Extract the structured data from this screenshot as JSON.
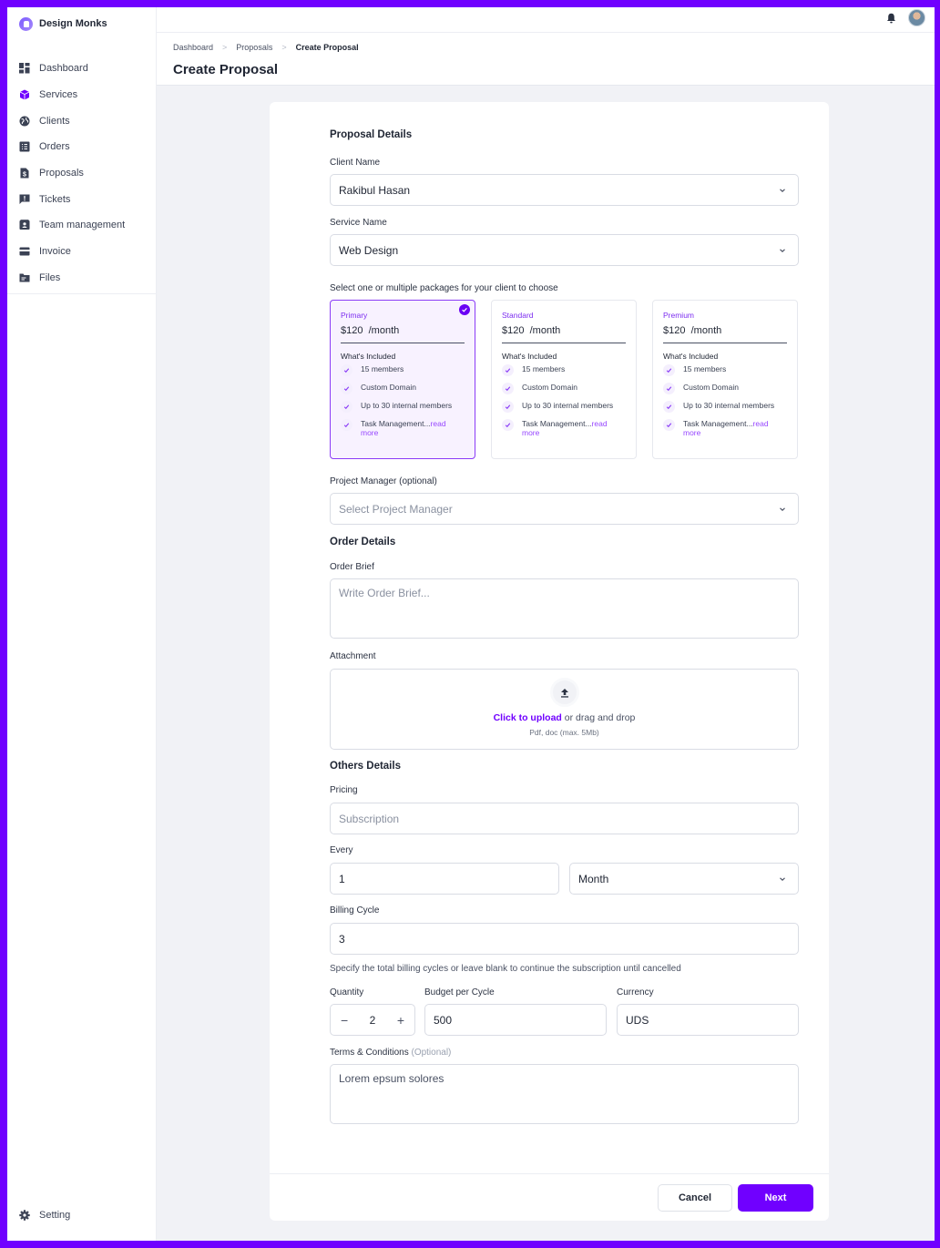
{
  "app": {
    "brand": "Design Monks",
    "colors": {
      "accent": "#7000ff",
      "frame": "#7000ff",
      "package_label": "#7c2df0"
    }
  },
  "sidebar": {
    "items": [
      {
        "label": "Dashboard",
        "icon": "dashboard-icon"
      },
      {
        "label": "Services",
        "icon": "box-icon"
      },
      {
        "label": "Clients",
        "icon": "globe-icon"
      },
      {
        "label": "Orders",
        "icon": "list-icon"
      },
      {
        "label": "Proposals",
        "icon": "document-dollar-icon"
      },
      {
        "label": "Tickets",
        "icon": "message-alert-icon"
      },
      {
        "label": "Team management",
        "icon": "contact-card-icon"
      },
      {
        "label": "Invoice",
        "icon": "credit-card-icon"
      },
      {
        "label": "Files",
        "icon": "folder-icon"
      }
    ],
    "setting": "Setting"
  },
  "breadcrumb": [
    "Dashboard",
    "Proposals",
    "Create Proposal"
  ],
  "page_title": "Create Proposal",
  "form": {
    "proposal_details_heading": "Proposal Details",
    "client_name": {
      "label": "Client Name",
      "value": "Rakibul Hasan"
    },
    "service_name": {
      "label": "Service Name",
      "value": "Web Design"
    },
    "packages_label": "Select one or multiple packages for your client to choose",
    "packages": [
      {
        "name": "Primary",
        "price": "$120",
        "period": "/month",
        "selected": true,
        "included_label": "What's Included",
        "features": [
          "15 members",
          "Custom Domain",
          "Up to 30 internal members",
          "Task Management..."
        ],
        "read_more": "read more"
      },
      {
        "name": "Standard",
        "price": "$120",
        "period": "/month",
        "selected": false,
        "included_label": "What's Included",
        "features": [
          "15 members",
          "Custom Domain",
          "Up to 30 internal members",
          "Task Management..."
        ],
        "read_more": "read more"
      },
      {
        "name": "Premium",
        "price": "$120",
        "period": "/month",
        "selected": false,
        "included_label": "What's Included",
        "features": [
          "15 members",
          "Custom Domain",
          "Up to 30 internal members",
          "Task Management..."
        ],
        "read_more": "read more"
      }
    ],
    "project_manager": {
      "label": "Project Manager (optional)",
      "placeholder": "Select Project Manager"
    },
    "order_details_heading": "Order Details",
    "order_brief": {
      "label": "Order Brief",
      "placeholder": "Write Order Brief..."
    },
    "attachment": {
      "label": "Attachment",
      "link": "Click to upload",
      "text": " or drag and drop",
      "hint": "Pdf, doc  (max. 5Mb)"
    },
    "others_details_heading": "Others Details",
    "pricing": {
      "label": "Pricing",
      "placeholder": "Subscription"
    },
    "every": {
      "label": "Every",
      "value": "1",
      "unit": "Month"
    },
    "billing_cycle": {
      "label": "Billing Cycle",
      "value": "3",
      "hint": "Specify the total billing cycles or leave blank to continue the subscription until cancelled"
    },
    "quantity": {
      "label": "Quantity",
      "value": "2",
      "minus": "−",
      "plus": "+"
    },
    "budget": {
      "label": "Budget per Cycle",
      "value": "500"
    },
    "currency": {
      "label": "Currency",
      "value": "UDS"
    },
    "terms": {
      "label": "Terms & Conditions",
      "optional": "(Optional)",
      "value": "Lorem epsum solores"
    }
  },
  "footer": {
    "cancel": "Cancel",
    "next": "Next"
  }
}
